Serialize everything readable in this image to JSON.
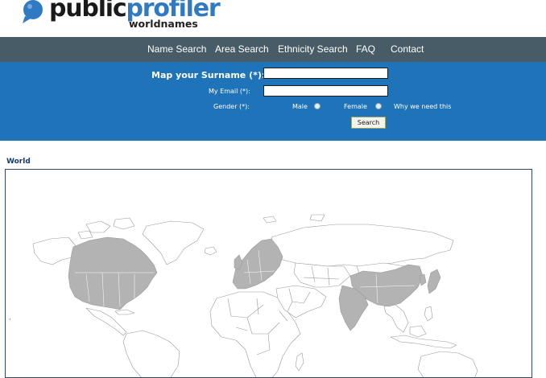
{
  "logo": {
    "brand_part1": "public",
    "brand_part2": "profiler",
    "subtitle": "worldnames"
  },
  "nav": {
    "items": [
      {
        "label": "Name Search"
      },
      {
        "label": "Area Search"
      },
      {
        "label": "Ethnicity Search"
      },
      {
        "label": "FAQ"
      },
      {
        "label": "Contact"
      }
    ]
  },
  "form": {
    "surname_label": "Map your Surname (*):",
    "surname_value": "",
    "email_label": "My Email (*):",
    "email_value": "",
    "gender_label": "Gender (*):",
    "gender_options": [
      {
        "label": "Male",
        "selected": false
      },
      {
        "label": "Female",
        "selected": false
      }
    ],
    "why_link": "Why we need this",
    "search_button": "Search"
  },
  "map": {
    "title": "World",
    "highlight_color": "#b3b3b3",
    "outline_color": "#9a9a9a"
  }
}
